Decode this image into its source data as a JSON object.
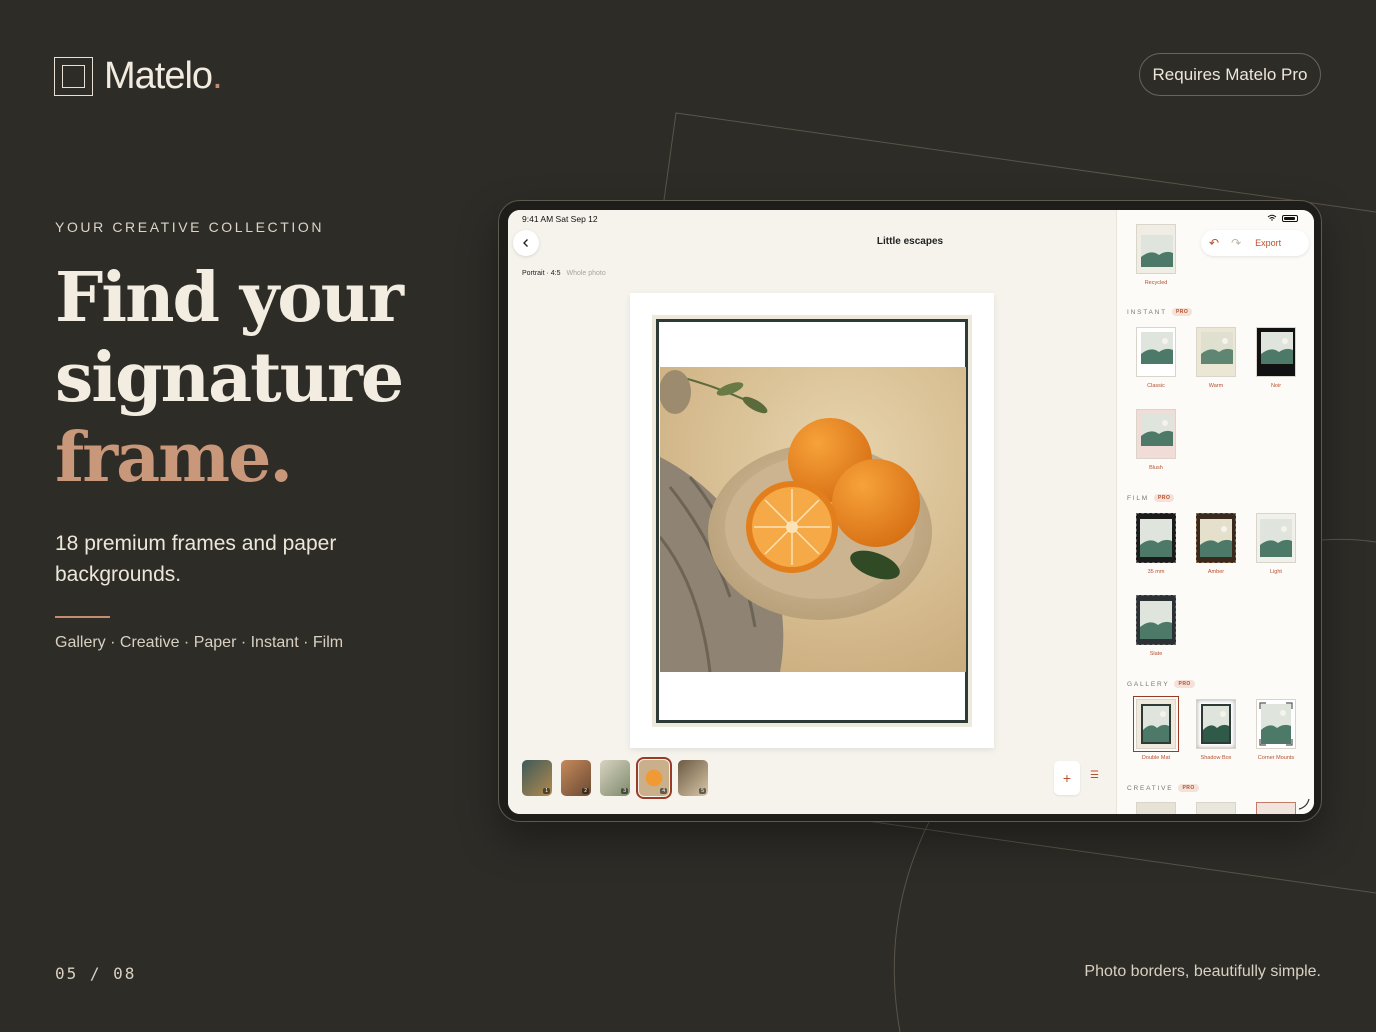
{
  "brand": {
    "name": "Matelo",
    "dot": ".",
    "pro_label": "Requires Matelo Pro"
  },
  "hero": {
    "eyebrow": "YOUR CREATIVE COLLECTION",
    "headline_1": "Find your",
    "headline_2": "signature",
    "headline_3": "frame.",
    "subtitle": "18 premium frames and paper backgrounds.",
    "categories": "Gallery · Creative · Paper · Instant · Film"
  },
  "footer": {
    "pager": "05 / 08",
    "tagline": "Photo borders, beautifully simple."
  },
  "colors": {
    "background": "#2e2c27",
    "accent": "#c48d70",
    "app_accent": "#b7502f"
  },
  "app": {
    "status_time": "9:41 AM   Sat Sep 12",
    "title": "Little escapes",
    "ratio": "Portrait · 4:5",
    "ratio_mode": "Whole photo",
    "export_label": "Export",
    "thumbnails": [
      {
        "num": "1",
        "selected": false
      },
      {
        "num": "2",
        "selected": false
      },
      {
        "num": "3",
        "selected": false
      },
      {
        "num": "4",
        "selected": true
      },
      {
        "num": "5",
        "selected": false
      }
    ],
    "add_icon": "plus-icon",
    "list_icon": "list-icon",
    "sidebar": {
      "recycled": "Recycled",
      "pro_tag": "PRO",
      "sections": {
        "instant": {
          "title": "INSTANT",
          "items": [
            "Classic",
            "Warm",
            "Noir",
            "Blush"
          ]
        },
        "film": {
          "title": "FILM",
          "items": [
            "35 mm",
            "Amber",
            "Light",
            "Slate"
          ]
        },
        "gallery": {
          "title": "GALLERY",
          "items": [
            "Double Mat",
            "Shadow Box",
            "Corner Mounts"
          ]
        },
        "creative": {
          "title": "CREATIVE"
        }
      },
      "selected_frame": "Double Mat"
    }
  }
}
